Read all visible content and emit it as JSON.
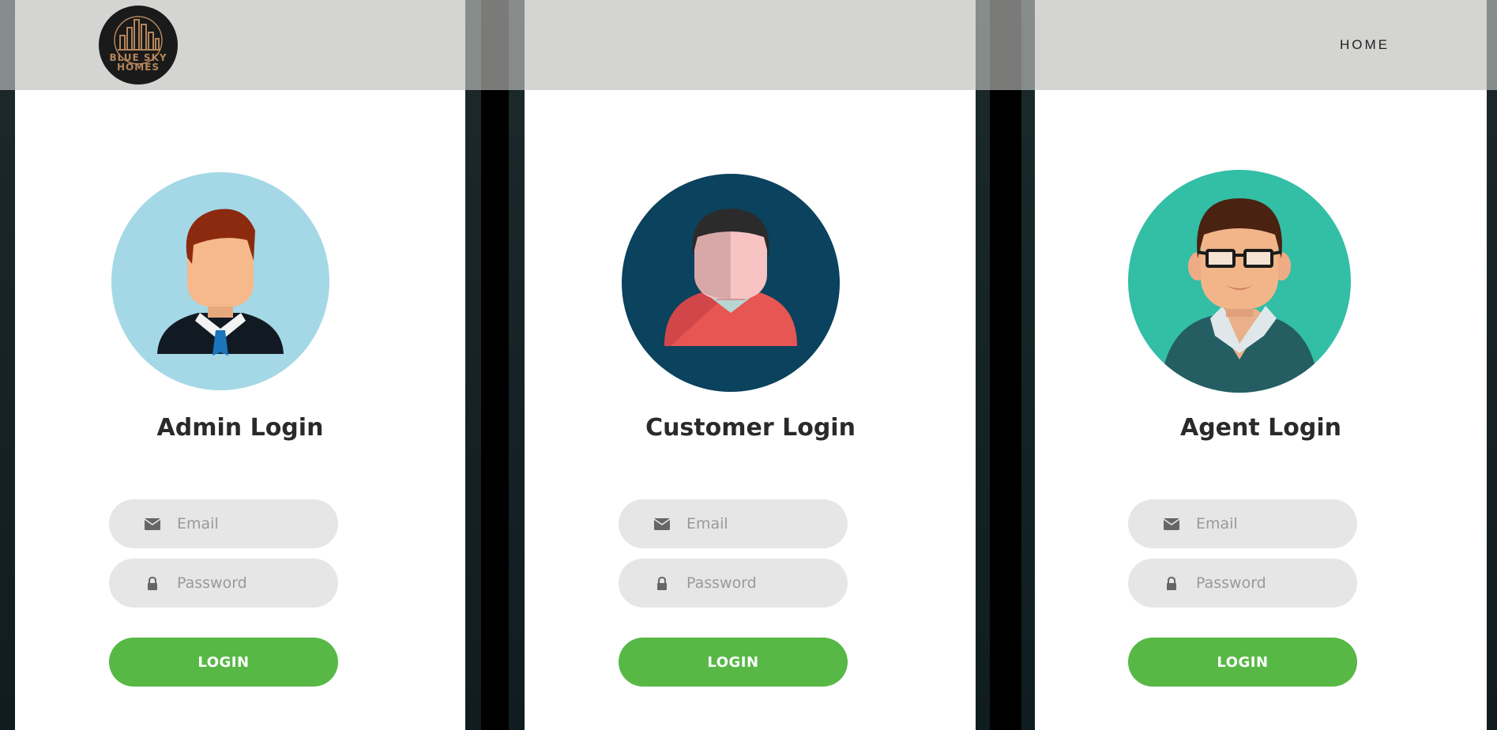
{
  "brand": {
    "logo_line1": "BLUE SKY",
    "logo_line2": "HOMES",
    "logo_color": "#b3855b"
  },
  "nav": {
    "home_label": "HOME"
  },
  "panels": [
    {
      "title": "Admin Login",
      "avatar_bg": "#a4d8e6",
      "email_placeholder": "Email",
      "password_placeholder": "Password",
      "button_label": "LOGIN"
    },
    {
      "title": "Customer Login",
      "avatar_bg": "#0b425d",
      "email_placeholder": "Email",
      "password_placeholder": "Password",
      "button_label": "LOGIN"
    },
    {
      "title": "Agent Login",
      "avatar_bg": "#33bea6",
      "email_placeholder": "Email",
      "password_placeholder": "Password",
      "button_label": "LOGIN"
    }
  ],
  "icons": {
    "email": "envelope-icon",
    "password": "lock-icon"
  },
  "colors": {
    "button": "#57b846",
    "field_bg": "#e6e6e6",
    "navbar": "#d4d4d2"
  }
}
